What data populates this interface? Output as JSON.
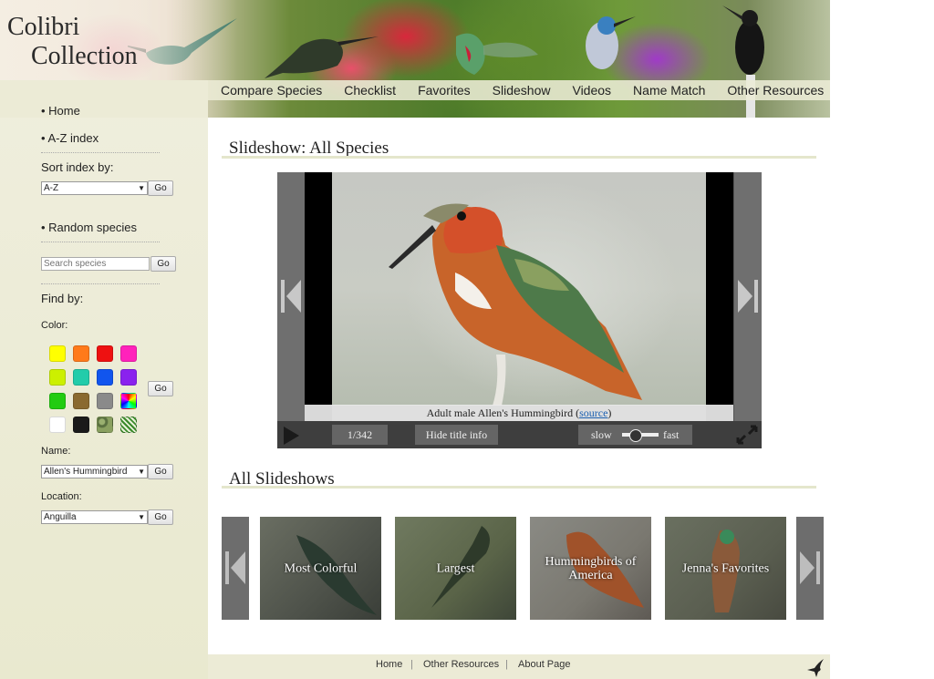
{
  "logo": {
    "line1": "Colibri",
    "line2": "Collection"
  },
  "nav": [
    "Compare Species",
    "Checklist",
    "Favorites",
    "Slideshow",
    "Videos",
    "Name Match",
    "Other Resources"
  ],
  "sidebar": {
    "home": "• Home",
    "az_index": "• A-Z index",
    "sort_label": "Sort index by:",
    "sort_value": "A-Z",
    "random": "• Random species",
    "search_placeholder": "Search species",
    "find_by": "Find by:",
    "color_label": "Color:",
    "colors": [
      "#ffff00",
      "#ff7a1a",
      "#ee1111",
      "#ff22bb",
      "#ccf000",
      "#22ccaa",
      "#1155ee",
      "#8a22ee",
      "#22cc11",
      "#8a6a30",
      "#8a8a8a",
      "rainbow",
      "#ffffff",
      "#1a1a1a",
      "mottled-green",
      "striped-green"
    ],
    "name_label": "Name:",
    "name_value": "Allen's Hummingbird",
    "location_label": "Location:",
    "location_value": "Anguilla",
    "go": "Go"
  },
  "slideshow": {
    "heading": "Slideshow: All Species",
    "caption": "Adult male Allen's Hummingbird",
    "source_label": "source",
    "counter": "1/342",
    "hide_title": "Hide title info",
    "slow": "slow",
    "fast": "fast",
    "speed_fraction": 0.35
  },
  "all_slideshows": {
    "heading": "All Slideshows",
    "items": [
      "Most Colorful",
      "Largest",
      "Hummingbirds of America",
      "Jenna's Favorites"
    ]
  },
  "footer": {
    "home": "Home",
    "other": "Other Resources",
    "about": "About Page"
  }
}
